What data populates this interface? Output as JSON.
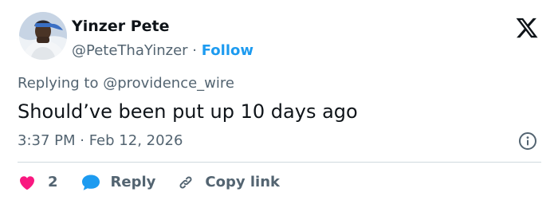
{
  "author": {
    "display_name": "Yinzer Pete",
    "handle": "@PeteThaYinzer",
    "separator": " · ",
    "follow_label": "Follow"
  },
  "platform_icon": "x-logo-icon",
  "reply_context": {
    "label": "Replying to @providence_wire"
  },
  "tweet": {
    "text": "Should’ve been put up 10 days ago",
    "timestamp": "3:37 PM · Feb 12, 2026"
  },
  "actions": {
    "like_count": "2",
    "reply_label": "Reply",
    "copy_link_label": "Copy link"
  },
  "icons": {
    "like": "heart-icon",
    "reply": "speech-bubble-icon",
    "copy": "link-icon",
    "info": "info-icon"
  },
  "colors": {
    "accent": "#1d9bf0",
    "like": "#f91880",
    "text_primary": "#0f1419",
    "text_secondary": "#536471",
    "divider": "#cfd9de"
  }
}
